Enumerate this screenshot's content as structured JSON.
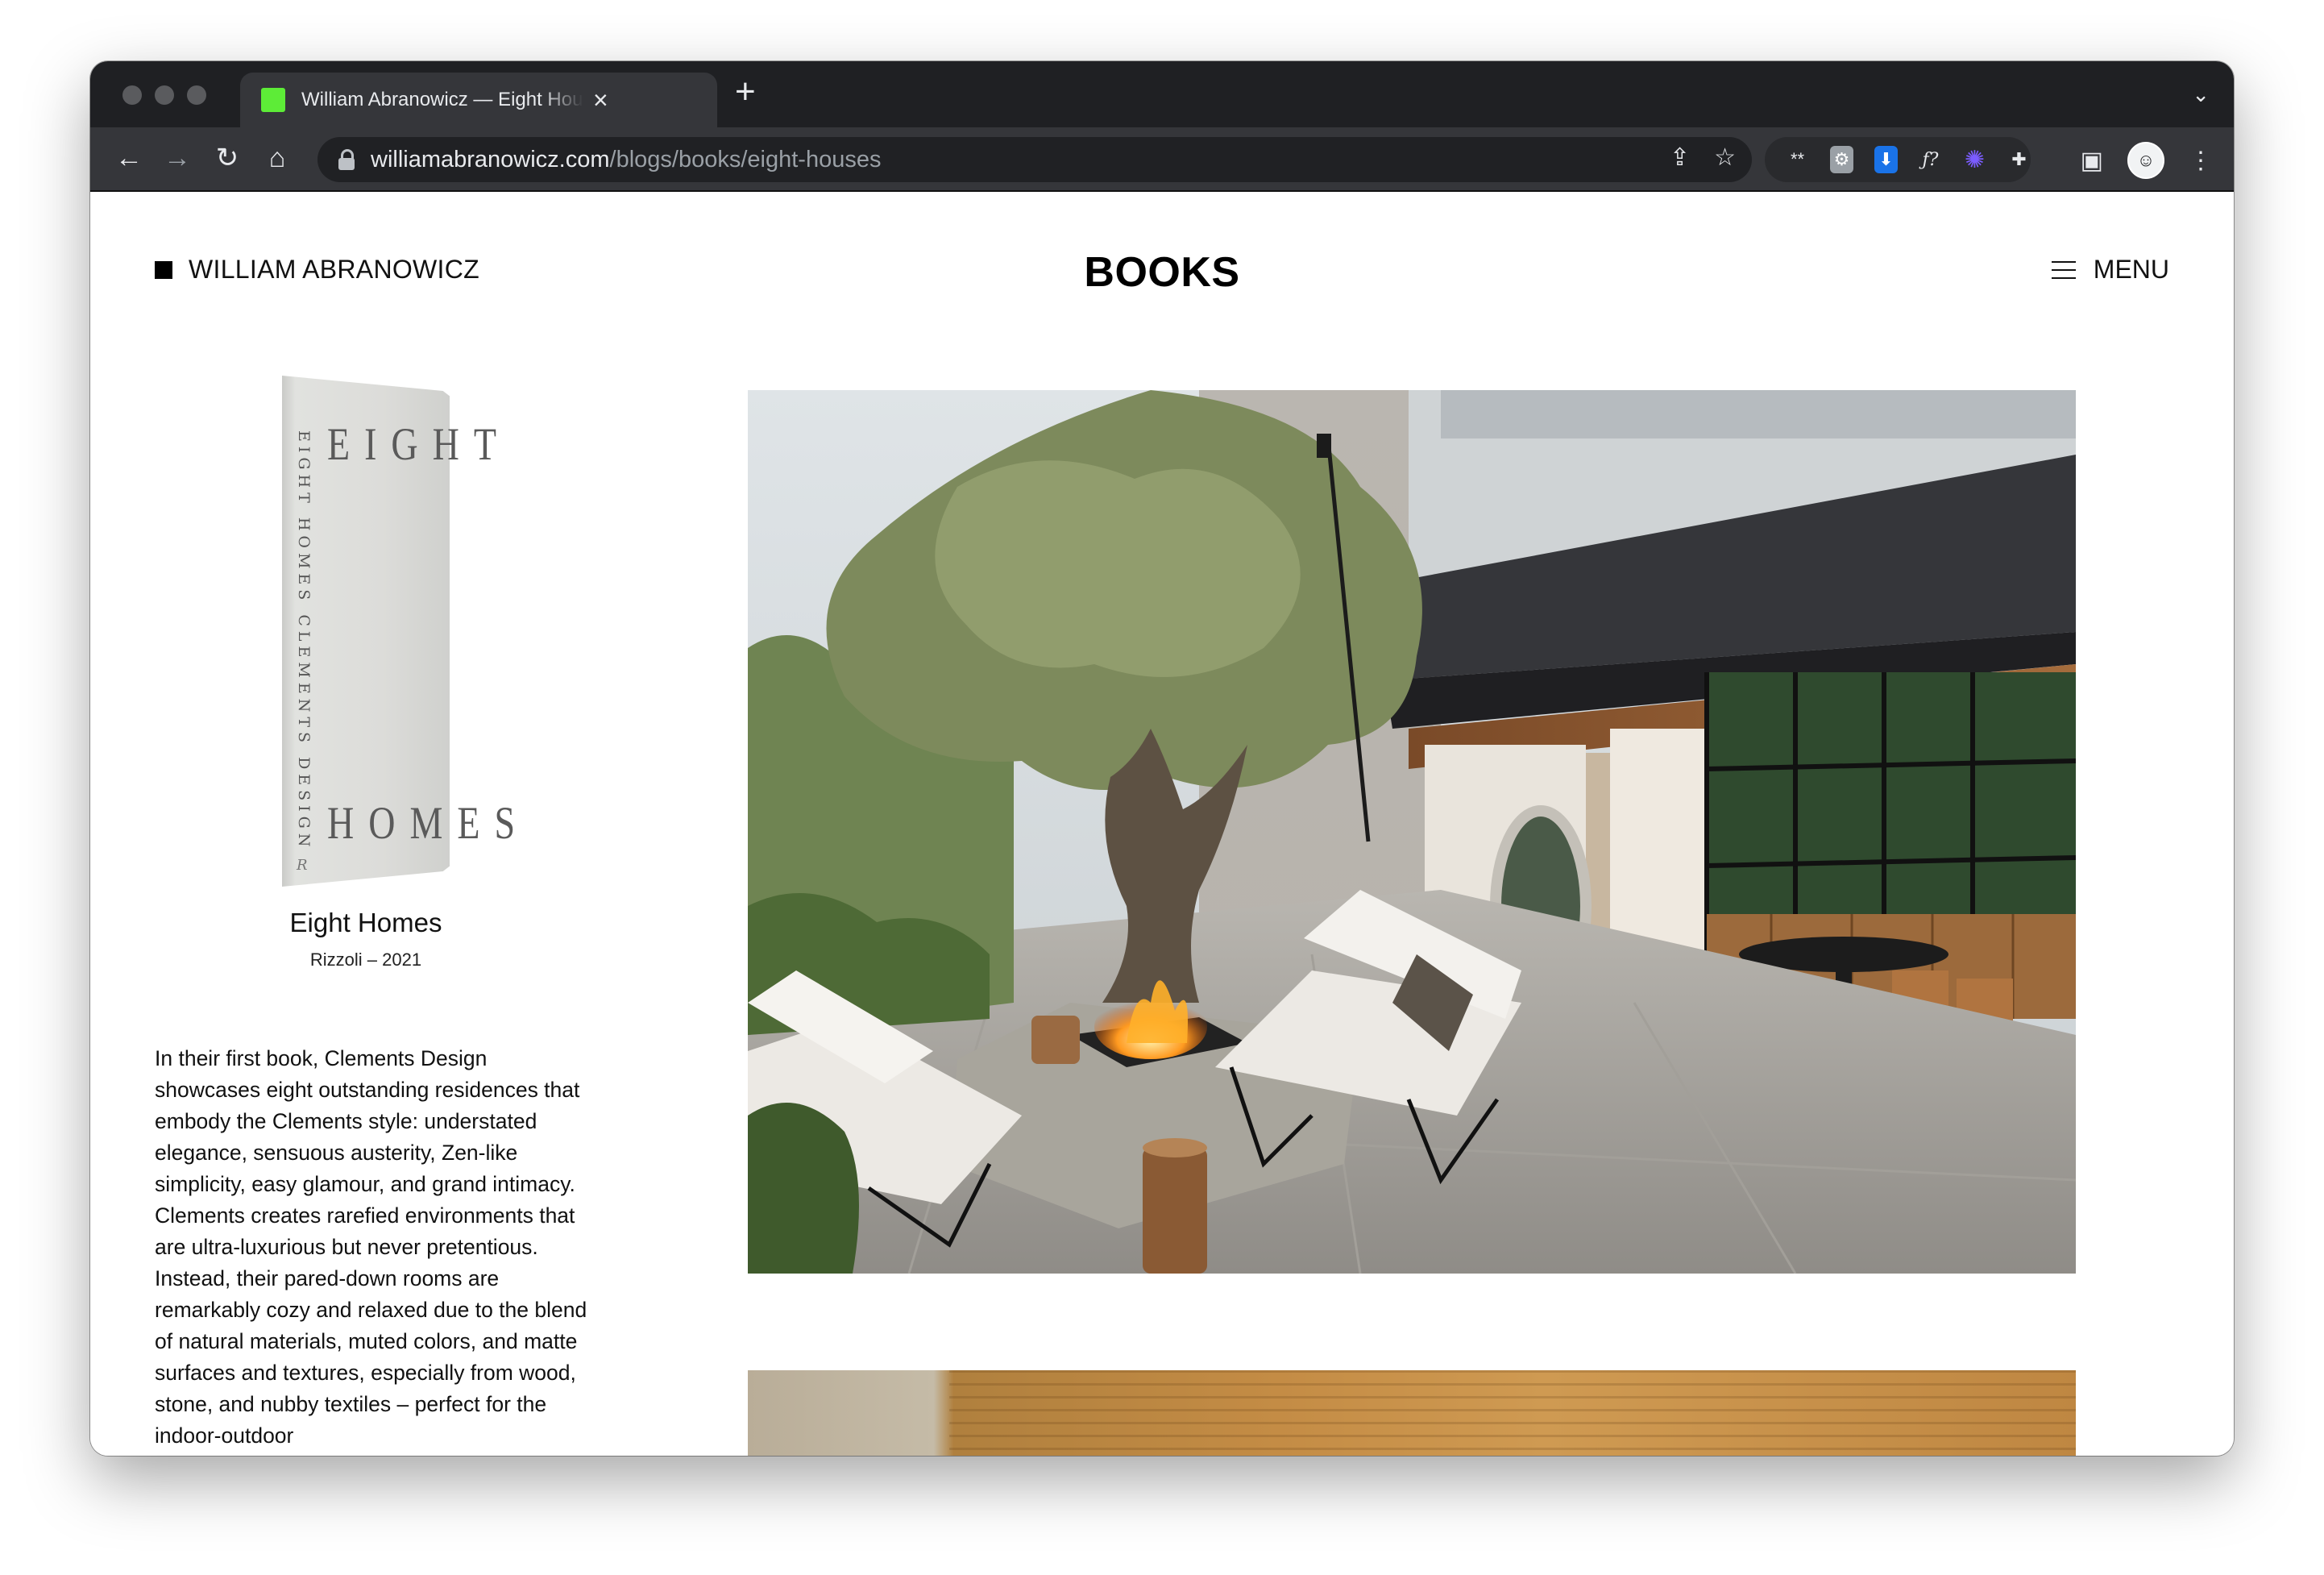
{
  "browser": {
    "tab_title": "William Abranowicz — Eight Houses",
    "url_domain": "williamabranowicz.com",
    "url_path": "/blogs/books/eight-houses"
  },
  "header": {
    "brand": "WILLIAM ABRANOWICZ",
    "page_title": "BOOKS",
    "menu_label": "MENU"
  },
  "book": {
    "cover_spine": "EIGHT HOMES   CLEMENTS DESIGN",
    "cover_word1": "EIGHT",
    "cover_word2": "HOMES",
    "title": "Eight Homes",
    "meta": "Rizzoli  –  2021",
    "description": "In their first book, Clements Design showcases eight outstanding residences that embody the Clements style: understated elegance, sensuous austerity, Zen-like simplicity, easy glamour, and grand intimacy. Clements creates rarefied environments that are ultra-luxurious but never pretentious. Instead, their pared-down rooms are remarkably cozy and relaxed due to the blend of natural materials, muted colors, and matte surfaces and textures, especially from wood, stone, and nubby textiles – perfect for the indoor-outdoor"
  },
  "colors": {
    "tab_favicon": "#5dec37",
    "chrome_dark": "#1f2023",
    "toolbar": "#35363a"
  },
  "icons": [
    "back-icon",
    "forward-icon",
    "reload-icon",
    "home-icon",
    "lock-icon",
    "share-icon",
    "star-icon",
    "extensions-icon",
    "sidebar-icon",
    "menu-dots-icon",
    "hamburger-icon"
  ]
}
